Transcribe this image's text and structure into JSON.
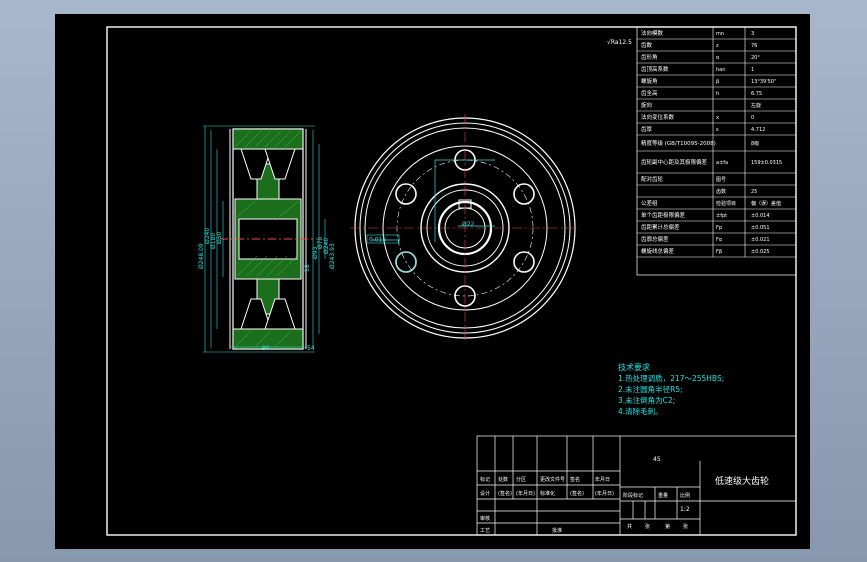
{
  "drawing": {
    "title": "低速级大齿轮",
    "roughness_mark": "√Ra12.5",
    "scale": "1:2",
    "material": "45"
  },
  "dimensions": {
    "side_view": [
      "Ø248.09",
      "Ø240",
      "Ø180",
      "Ø50",
      "Ø70",
      "Ø240",
      "Ø93",
      "Ø243.93",
      "90",
      "18",
      "54"
    ],
    "front_view": [
      "Ø15",
      "Ø22"
    ],
    "tolerance": "0.015"
  },
  "gear_params": [
    {
      "name": "法向模数",
      "symbol": "mn",
      "value": "3"
    },
    {
      "name": "齿数",
      "symbol": "z",
      "value": "76"
    },
    {
      "name": "齿形角",
      "symbol": "α",
      "value": "20°"
    },
    {
      "name": "齿顶高系数",
      "symbol": "han",
      "value": "1"
    },
    {
      "name": "螺旋角",
      "symbol": "β",
      "value": "13°39'50\""
    },
    {
      "name": "齿全高",
      "symbol": "h",
      "value": "6.75"
    },
    {
      "name": "旋向",
      "symbol": "",
      "value": "左旋"
    },
    {
      "name": "法向变位系数",
      "symbol": "x",
      "value": "0"
    },
    {
      "name": "齿厚",
      "symbol": "s",
      "value": "4.712"
    },
    {
      "name": "精度等级 (GB/T10095-2008)",
      "symbol": "",
      "value": "8级"
    },
    {
      "name": "齿轮副中心距及其极限偏差",
      "symbol": "a±fa",
      "value": "159±0.0315"
    },
    {
      "name": "配对齿轮",
      "symbol": "图号",
      "value": ""
    },
    {
      "name": "",
      "symbol": "齿数",
      "value": "25"
    },
    {
      "name": "公差组",
      "symbol": "检验项目",
      "value": "偏（误）差值"
    },
    {
      "name": "单个齿距极限偏差",
      "symbol": "±fpt",
      "value": "±0.014"
    },
    {
      "name": "齿距累计总偏差",
      "symbol": "Fp",
      "value": "±0.051"
    },
    {
      "name": "齿廓总偏差",
      "symbol": "Fα",
      "value": "±0.021"
    },
    {
      "name": "螺旋线总偏差",
      "symbol": "Fβ",
      "value": "±0.025"
    }
  ],
  "tech_requirements": {
    "heading": "技术要求",
    "items": [
      "1.热处理调质，217～255HBS;",
      "2.未注圆角半径R5;",
      "3.未注倒角为C2;",
      "4.清除毛刺。"
    ]
  },
  "title_block": {
    "labels": [
      "标记",
      "处数",
      "分区",
      "更改文件号",
      "签名",
      "年月日"
    ],
    "labels2": [
      "设计",
      "(签名)",
      "(年月日)",
      "标准化",
      "(签名)",
      "(年月日)"
    ],
    "labels3": [
      "阶段标记",
      "重量",
      "比例"
    ],
    "labels4": [
      "审核",
      "工艺",
      "批准"
    ],
    "labels5": [
      "共",
      "张",
      "第",
      "张"
    ]
  }
}
